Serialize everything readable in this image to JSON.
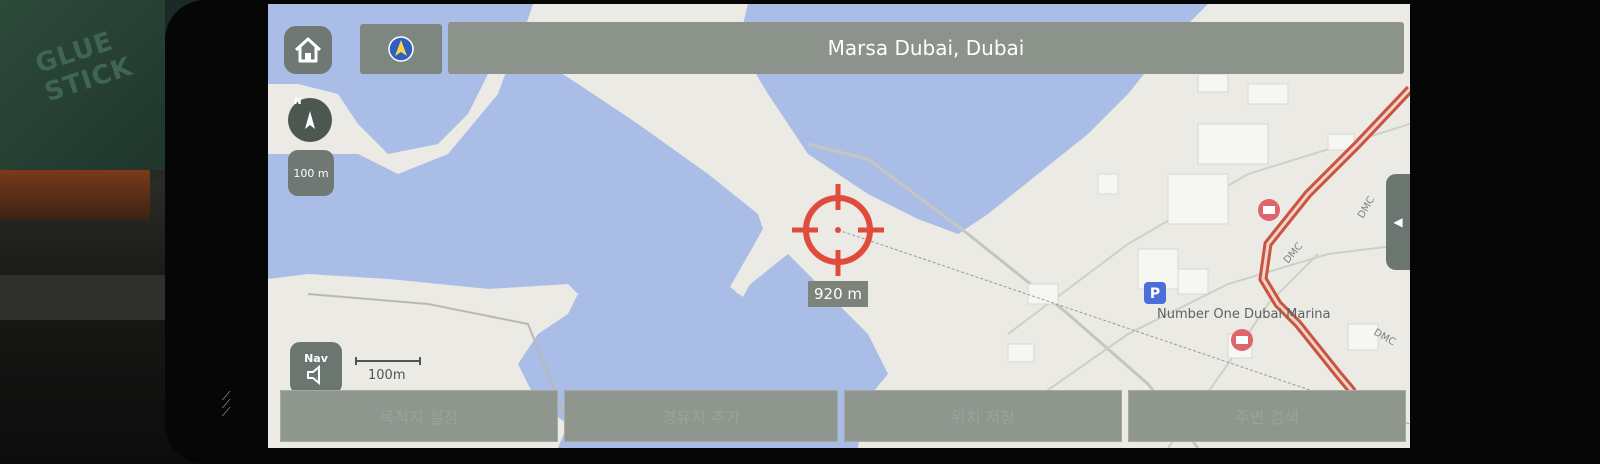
{
  "header": {
    "location_title": "Marsa Dubai, Dubai"
  },
  "map_controls": {
    "compass_letter": "N",
    "zoom_label": "100 m",
    "nav_label": "Nav",
    "scale_bar_label": "100m"
  },
  "cursor": {
    "distance": "920 m"
  },
  "poi": {
    "label": "Number One Dubai Marina"
  },
  "road_labels": [
    "DMC",
    "DMC",
    "DMC"
  ],
  "bottom_bar": {
    "buttons": [
      "목적지 설정",
      "경유지 추가",
      "위치 저장",
      "주변 검색"
    ]
  },
  "background": {
    "box_text": "GLUE STICK"
  },
  "colors": {
    "water": "#a9bde6",
    "land": "#ebeae4",
    "road": "#c8c8c2",
    "highway": "#c9543f",
    "cursor": "#e04b3c",
    "poi_marker": "#e0646b",
    "parking": "#4a6fd8"
  }
}
